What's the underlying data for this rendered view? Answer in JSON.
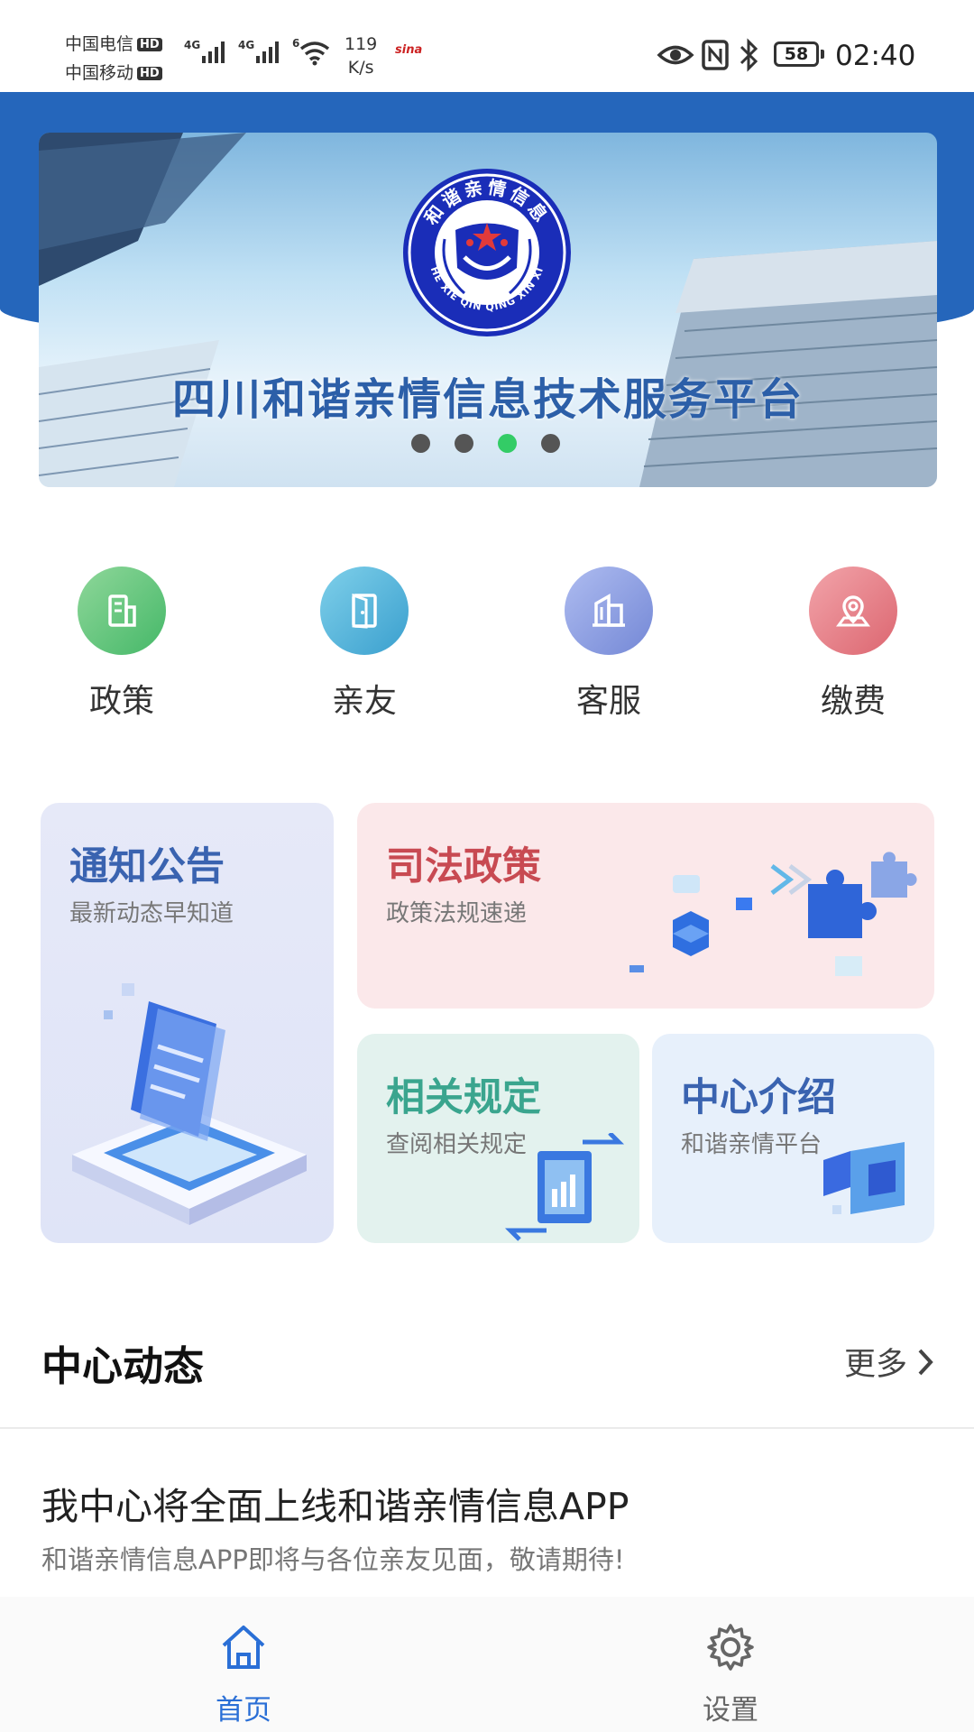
{
  "status_bar": {
    "carrier1": "中国电信",
    "carrier2": "中国移动",
    "hd": "HD",
    "net1": "4G",
    "net2": "4G",
    "wifi": "6",
    "speed_value": "119",
    "speed_unit": "K/s",
    "sina": "sina",
    "battery": "58",
    "time": "02:40"
  },
  "banner": {
    "title": "四川和谐亲情信息技术服务平台",
    "emblem_text": "和谐亲情信息",
    "emblem_pinyin": "HE XIE QIN QING XIN XI",
    "dot_count": 4,
    "active_dot": 2
  },
  "quick_menu": [
    {
      "label": "政策",
      "icon": "building-icon",
      "color": "#5fbf7a"
    },
    {
      "label": "亲友",
      "icon": "door-icon",
      "color": "#48b1d9"
    },
    {
      "label": "客服",
      "icon": "office-icon",
      "color": "#8d9fe0"
    },
    {
      "label": "缴费",
      "icon": "location-pin-icon",
      "color": "#e5828a"
    }
  ],
  "cards": {
    "notice": {
      "title": "通知公告",
      "subtitle": "最新动态早知道",
      "title_color": "#3a63b0"
    },
    "judicial": {
      "title": "司法政策",
      "subtitle": "政策法规速递",
      "title_color": "#c84a52"
    },
    "regulations": {
      "title": "相关规定",
      "subtitle": "查阅相关规定",
      "title_color": "#3aa58e"
    },
    "about": {
      "title": "中心介绍",
      "subtitle": "和谐亲情平台",
      "title_color": "#3a63b0"
    }
  },
  "news_section": {
    "title": "中心动态",
    "more": "更多",
    "items": [
      {
        "title": "我中心将全面上线和谐亲情信息APP",
        "summary": "和谐亲情信息APP即将与各位亲友见面，敬请期待!"
      }
    ]
  },
  "tabbar": {
    "tabs": [
      {
        "label": "首页",
        "active": true
      },
      {
        "label": "设置",
        "active": false
      }
    ],
    "active_color": "#2a6fd6",
    "inactive_color": "#666666"
  }
}
